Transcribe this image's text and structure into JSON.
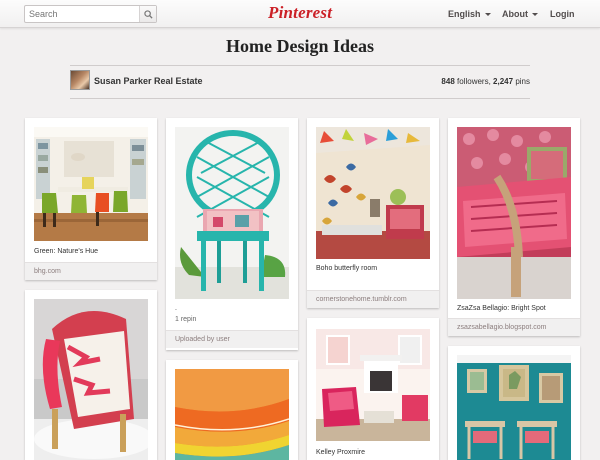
{
  "header": {
    "search_placeholder": "Search",
    "logo_text": "Pinterest",
    "language_label": "English",
    "about_label": "About",
    "login_label": "Login"
  },
  "board": {
    "title": "Home Design Ideas",
    "owner_name": "Susan Parker Real Estate",
    "followers_count": "848",
    "followers_label": "followers,",
    "pins_count": "2,247",
    "pins_label": "pins"
  },
  "pins": [
    {
      "description": "Green: Nature's Hue",
      "source": "bhg.com"
    },
    {
      "description": "",
      "source": ""
    },
    {
      "description": ".",
      "repins": "1 repin",
      "source": "Uploaded by user"
    },
    {
      "description": "",
      "source": ""
    },
    {
      "description": "Boho butterfly room",
      "source": "cornerstonehome.tumblr.com"
    },
    {
      "description": "Kelley Proxmire",
      "source": ""
    },
    {
      "description": "ZsaZsa Bellagio: Bright Spot",
      "source": "zsazsabellagio.blogspot.com"
    },
    {
      "description": "",
      "source": ""
    }
  ],
  "colors": {
    "brand_red": "#cb2027",
    "page_background": "#f2f0f0"
  }
}
